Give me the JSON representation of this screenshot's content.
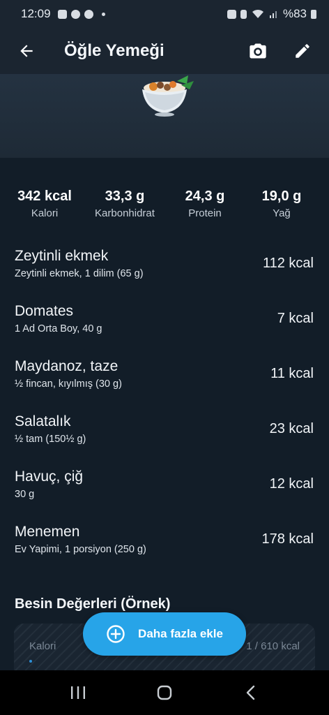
{
  "status_bar": {
    "time": "12:09",
    "battery": "%83",
    "icons": [
      "notification-icon",
      "photo-icon",
      "messenger-icon",
      "alarm-icon",
      "bluetooth-icon",
      "wifi-icon",
      "signal-icon",
      "battery-icon"
    ]
  },
  "app_bar": {
    "title": "Öğle Yemeği",
    "icons": [
      "back-arrow-icon",
      "camera-icon",
      "edit-pencil-icon"
    ]
  },
  "header_image": "food-bowl-image",
  "summary": [
    {
      "value": "342 kcal",
      "label": "Kalori"
    },
    {
      "value": "33,3 g",
      "label": "Karbonhidrat"
    },
    {
      "value": "24,3 g",
      "label": "Protein"
    },
    {
      "value": "19,0 g",
      "label": "Yağ"
    }
  ],
  "foods": [
    {
      "name": "Zeytinli ekmek",
      "desc": "Zeytinli ekmek, 1 dilim (65 g)",
      "kcal": "112 kcal"
    },
    {
      "name": "Domates",
      "desc": "1 Ad Orta Boy, 40 g",
      "kcal": "7 kcal"
    },
    {
      "name": "Maydanoz, taze",
      "desc": "½ fincan, kıyılmış (30 g)",
      "kcal": "11 kcal"
    },
    {
      "name": "Salatalık",
      "desc": "½ tam (150½ g)",
      "kcal": "23 kcal"
    },
    {
      "name": "Havuç, çiğ",
      "desc": "30 g",
      "kcal": "12 kcal"
    },
    {
      "name": "Menemen",
      "desc": "Ev Yapimi, 1 porsiyon (250 g)",
      "kcal": "178 kcal"
    }
  ],
  "nutrition": {
    "title": "Besin Değerleri (Örnek)",
    "row_label": "Kalori",
    "row_value": "1 / 610 kcal"
  },
  "fab": {
    "label": "Daha fazla ekle",
    "icon": "plus-circle-icon"
  },
  "colors": {
    "app_bar": "#1b2530",
    "background": "#121d28",
    "accent": "#27a4e8"
  }
}
